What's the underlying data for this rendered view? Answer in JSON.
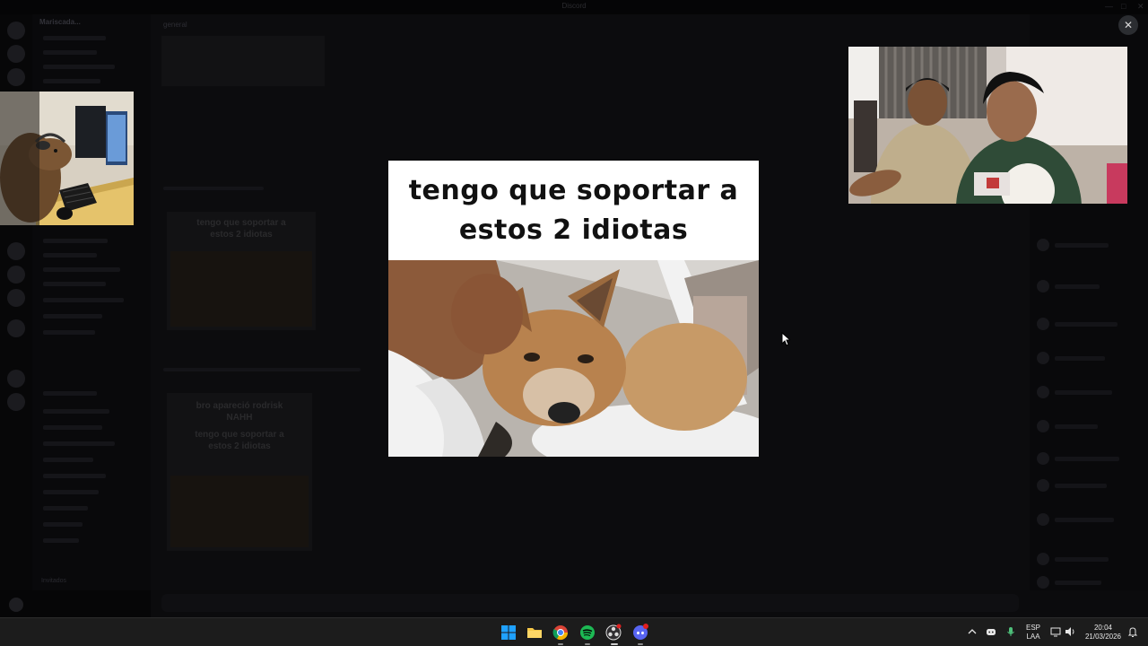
{
  "window": {
    "title": "Discord"
  },
  "server": {
    "name": "Mariscada..."
  },
  "channel": {
    "name": "general"
  },
  "chat": {
    "embeds": [
      {
        "caption_line1": "tengo que soportar a",
        "caption_line2": "estos 2 idiotas"
      },
      {
        "caption_line1": "bro apareció rodrisk",
        "caption_line2": "NAHH",
        "caption_line3": "tengo que soportar a",
        "caption_line4": "estos 2 idiotas"
      }
    ]
  },
  "channels_footer": "Invitados",
  "viewer": {
    "caption_line1": "tengo que soportar a",
    "caption_line2": "estos 2 idiotas"
  },
  "close_icon": "close-icon",
  "taskbar": {
    "apps": [
      "windows-start-icon",
      "file-explorer-icon",
      "chrome-icon",
      "spotify-icon",
      "obs-icon",
      "discord-icon"
    ],
    "language_line1": "ESP",
    "language_line2": "LAA",
    "time": "20:04",
    "date": "21/03/2026"
  },
  "colors": {
    "accent_blue": "#0078d4",
    "discord": "#5865f2",
    "spotify": "#1db954",
    "overlay": "#000000"
  }
}
